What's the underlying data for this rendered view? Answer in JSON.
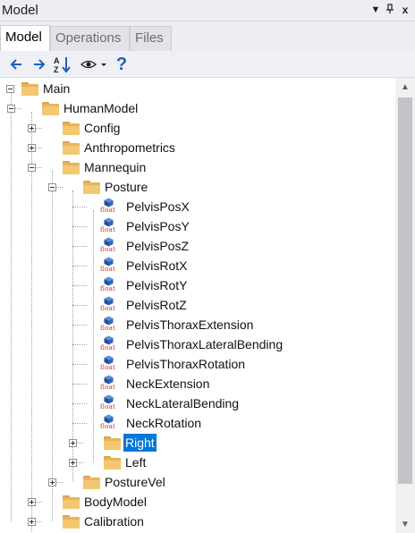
{
  "panel": {
    "title": "Model",
    "pin_icon": "pin-icon",
    "close_icon": "close-icon",
    "dropdown_icon": "dropdown-icon",
    "close_glyph": "x"
  },
  "tabs": [
    {
      "label": "Model",
      "active": true
    },
    {
      "label": "Operations",
      "active": false
    },
    {
      "label": "Files",
      "active": false
    }
  ],
  "toolbar": {
    "back_icon": "back-arrow-icon",
    "forward_icon": "forward-arrow-icon",
    "sort_icon": "sort-az-icon",
    "view_icon": "eye-icon",
    "help_icon": "help-icon",
    "help_glyph": "?",
    "accent": "#1c62b9"
  },
  "tree": {
    "float_tag": "float",
    "selected_color": "#0078d7",
    "items": [
      {
        "label": "Main",
        "type": "folder",
        "expanded": true
      },
      {
        "label": "HumanModel",
        "type": "folder",
        "expanded": true
      },
      {
        "label": "Config",
        "type": "folder",
        "expanded": false
      },
      {
        "label": "Anthropometrics",
        "type": "folder",
        "expanded": false
      },
      {
        "label": "Mannequin",
        "type": "folder",
        "expanded": true
      },
      {
        "label": "Posture",
        "type": "folder",
        "expanded": true
      },
      {
        "label": "PelvisPosX",
        "type": "float"
      },
      {
        "label": "PelvisPosY",
        "type": "float"
      },
      {
        "label": "PelvisPosZ",
        "type": "float"
      },
      {
        "label": "PelvisRotX",
        "type": "float"
      },
      {
        "label": "PelvisRotY",
        "type": "float"
      },
      {
        "label": "PelvisRotZ",
        "type": "float"
      },
      {
        "label": "PelvisThoraxExtension",
        "type": "float"
      },
      {
        "label": "PelvisThoraxLateralBending",
        "type": "float"
      },
      {
        "label": "PelvisThoraxRotation",
        "type": "float"
      },
      {
        "label": "NeckExtension",
        "type": "float"
      },
      {
        "label": "NeckLateralBending",
        "type": "float"
      },
      {
        "label": "NeckRotation",
        "type": "float"
      },
      {
        "label": "Right",
        "type": "folder",
        "expanded": false,
        "selected": true
      },
      {
        "label": "Left",
        "type": "folder",
        "expanded": false
      },
      {
        "label": "PostureVel",
        "type": "folder",
        "expanded": false
      },
      {
        "label": "BodyModel",
        "type": "folder",
        "expanded": false
      },
      {
        "label": "Calibration",
        "type": "folder",
        "expanded": false
      }
    ]
  }
}
